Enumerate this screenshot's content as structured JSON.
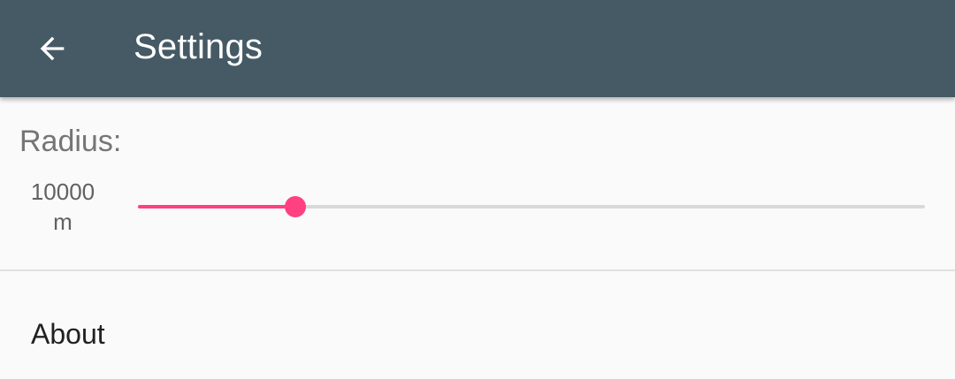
{
  "app_bar": {
    "title": "Settings",
    "background_color": "#455a64",
    "back_icon": "arrow-back-icon"
  },
  "radius": {
    "label": "Radius:",
    "value_line1": "10000",
    "value_line2": "m",
    "slider_fraction": 0.2,
    "accent_color": "#ff4081"
  },
  "about": {
    "label": "About"
  }
}
